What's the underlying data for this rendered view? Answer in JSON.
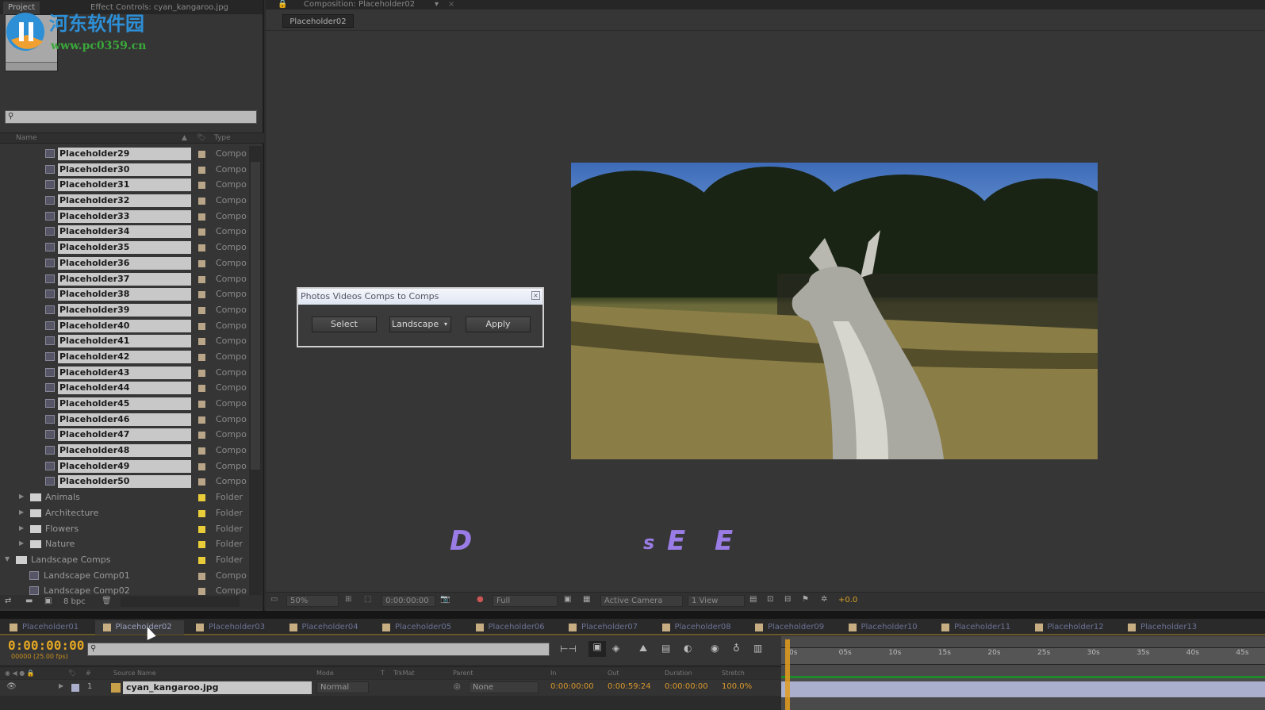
{
  "watermark": {
    "site_name": "河东软件园",
    "url": "www.pc0359.cn"
  },
  "project": {
    "tabs": [
      "Project",
      "Effect Controls: cyan_kangaroo.jpg"
    ],
    "search_placeholder": "",
    "columns": {
      "name": "Name",
      "type": "Type"
    },
    "items": [
      {
        "name": "Placeholder29",
        "type": "Compo",
        "kind": "comp",
        "selected": true
      },
      {
        "name": "Placeholder30",
        "type": "Compo",
        "kind": "comp",
        "selected": true
      },
      {
        "name": "Placeholder31",
        "type": "Compo",
        "kind": "comp",
        "selected": true
      },
      {
        "name": "Placeholder32",
        "type": "Compo",
        "kind": "comp",
        "selected": true
      },
      {
        "name": "Placeholder33",
        "type": "Compo",
        "kind": "comp",
        "selected": true
      },
      {
        "name": "Placeholder34",
        "type": "Compo",
        "kind": "comp",
        "selected": true
      },
      {
        "name": "Placeholder35",
        "type": "Compo",
        "kind": "comp",
        "selected": true
      },
      {
        "name": "Placeholder36",
        "type": "Compo",
        "kind": "comp",
        "selected": true
      },
      {
        "name": "Placeholder37",
        "type": "Compo",
        "kind": "comp",
        "selected": true
      },
      {
        "name": "Placeholder38",
        "type": "Compo",
        "kind": "comp",
        "selected": true
      },
      {
        "name": "Placeholder39",
        "type": "Compo",
        "kind": "comp",
        "selected": true
      },
      {
        "name": "Placeholder40",
        "type": "Compo",
        "kind": "comp",
        "selected": true
      },
      {
        "name": "Placeholder41",
        "type": "Compo",
        "kind": "comp",
        "selected": true
      },
      {
        "name": "Placeholder42",
        "type": "Compo",
        "kind": "comp",
        "selected": true
      },
      {
        "name": "Placeholder43",
        "type": "Compo",
        "kind": "comp",
        "selected": true
      },
      {
        "name": "Placeholder44",
        "type": "Compo",
        "kind": "comp",
        "selected": true
      },
      {
        "name": "Placeholder45",
        "type": "Compo",
        "kind": "comp",
        "selected": true
      },
      {
        "name": "Placeholder46",
        "type": "Compo",
        "kind": "comp",
        "selected": true
      },
      {
        "name": "Placeholder47",
        "type": "Compo",
        "kind": "comp",
        "selected": true
      },
      {
        "name": "Placeholder48",
        "type": "Compo",
        "kind": "comp",
        "selected": true
      },
      {
        "name": "Placeholder49",
        "type": "Compo",
        "kind": "comp",
        "selected": true
      },
      {
        "name": "Placeholder50",
        "type": "Compo",
        "kind": "comp",
        "selected": true
      },
      {
        "name": "Animals",
        "type": "Folder",
        "kind": "folder",
        "level": 1
      },
      {
        "name": "Architecture",
        "type": "Folder",
        "kind": "folder",
        "level": 1
      },
      {
        "name": "Flowers",
        "type": "Folder",
        "kind": "folder",
        "level": 1
      },
      {
        "name": "Nature",
        "type": "Folder",
        "kind": "folder",
        "level": 1
      },
      {
        "name": "Landscape Comps",
        "type": "Folder",
        "kind": "folder",
        "level": 0,
        "expanded": true
      },
      {
        "name": "Landscape Comp01",
        "type": "Compo",
        "kind": "subcomp"
      },
      {
        "name": "Landscape Comp02",
        "type": "Compo",
        "kind": "subcomp"
      }
    ],
    "bit_depth": "8 bpc"
  },
  "composition": {
    "tab": "Composition: Placeholder02",
    "subtab": "Placeholder02",
    "overlay_letters": [
      "D",
      "s",
      "E",
      "E"
    ],
    "dialog": {
      "title": "Photos Videos Comps to Comps",
      "select": "Select",
      "dropdown": "Landscape",
      "apply": "Apply"
    },
    "toolbar": {
      "zoom": "50%",
      "timecode": "0:00:00:00",
      "resolution": "Full",
      "camera": "Active Camera",
      "views": "1 View",
      "exposure": "+0.0"
    }
  },
  "timeline": {
    "tabs": [
      "Placeholder01",
      "Placeholder02",
      "Placeholder03",
      "Placeholder04",
      "Placeholder05",
      "Placeholder06",
      "Placeholder07",
      "Placeholder08",
      "Placeholder09",
      "Placeholder10",
      "Placeholder11",
      "Placeholder12",
      "Placeholder13"
    ],
    "active_tab": 1,
    "timecode": "0:00:00:00",
    "fps": "00000 (25.00 fps)",
    "columns": [
      "Source Name",
      "Mode",
      "T",
      "TrkMat",
      "Parent",
      "In",
      "Out",
      "Duration",
      "Stretch"
    ],
    "layer": {
      "index": "1",
      "name": "cyan_kangaroo.jpg",
      "mode": "Normal",
      "parent": "None",
      "in": "0:00:00:00",
      "out": "0:00:59:24",
      "duration": "0:00:00:00",
      "stretch": "100.0%"
    },
    "ruler_ticks": [
      "0s",
      "05s",
      "10s",
      "15s",
      "20s",
      "25s",
      "30s",
      "35s",
      "40s",
      "45s"
    ]
  }
}
